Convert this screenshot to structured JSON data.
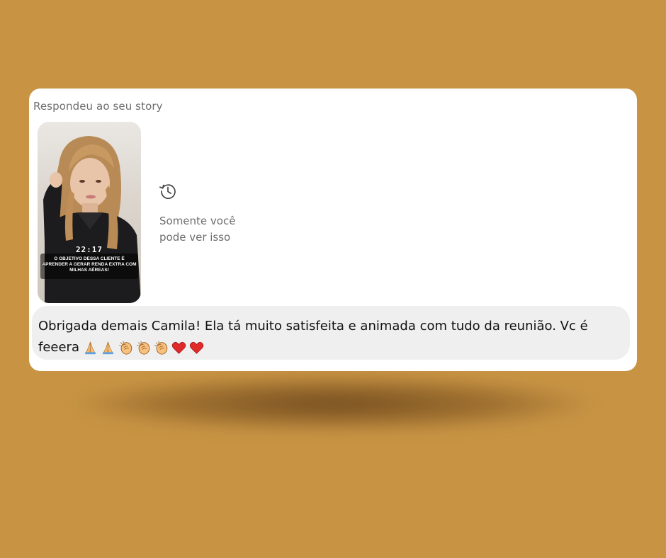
{
  "story_reply": {
    "label": "Respondeu ao seu story",
    "story": {
      "time_overlay": "22:17",
      "caption": "O objetivo dessa cliente é aprender a gerar renda extra com milhas aéreas!"
    },
    "ephemeral": {
      "icon": "history-clock-icon",
      "text_line1": "Somente você",
      "text_line2": "pode ver isso"
    }
  },
  "message": {
    "text": "Obrigada demais Camila! Ela tá muito satisfeita e animada com tudo da reunião. Vc é feeera",
    "emojis": [
      "folded-hands-icon",
      "folded-hands-icon",
      "clapping-hands-icon",
      "clapping-hands-icon",
      "clapping-hands-icon",
      "red-heart-icon",
      "red-heart-icon"
    ]
  },
  "colors": {
    "background": "#c89444",
    "card": "#ffffff",
    "bubble": "#efefef",
    "muted_text": "#6e6e6e",
    "heart": "#e0245e"
  }
}
